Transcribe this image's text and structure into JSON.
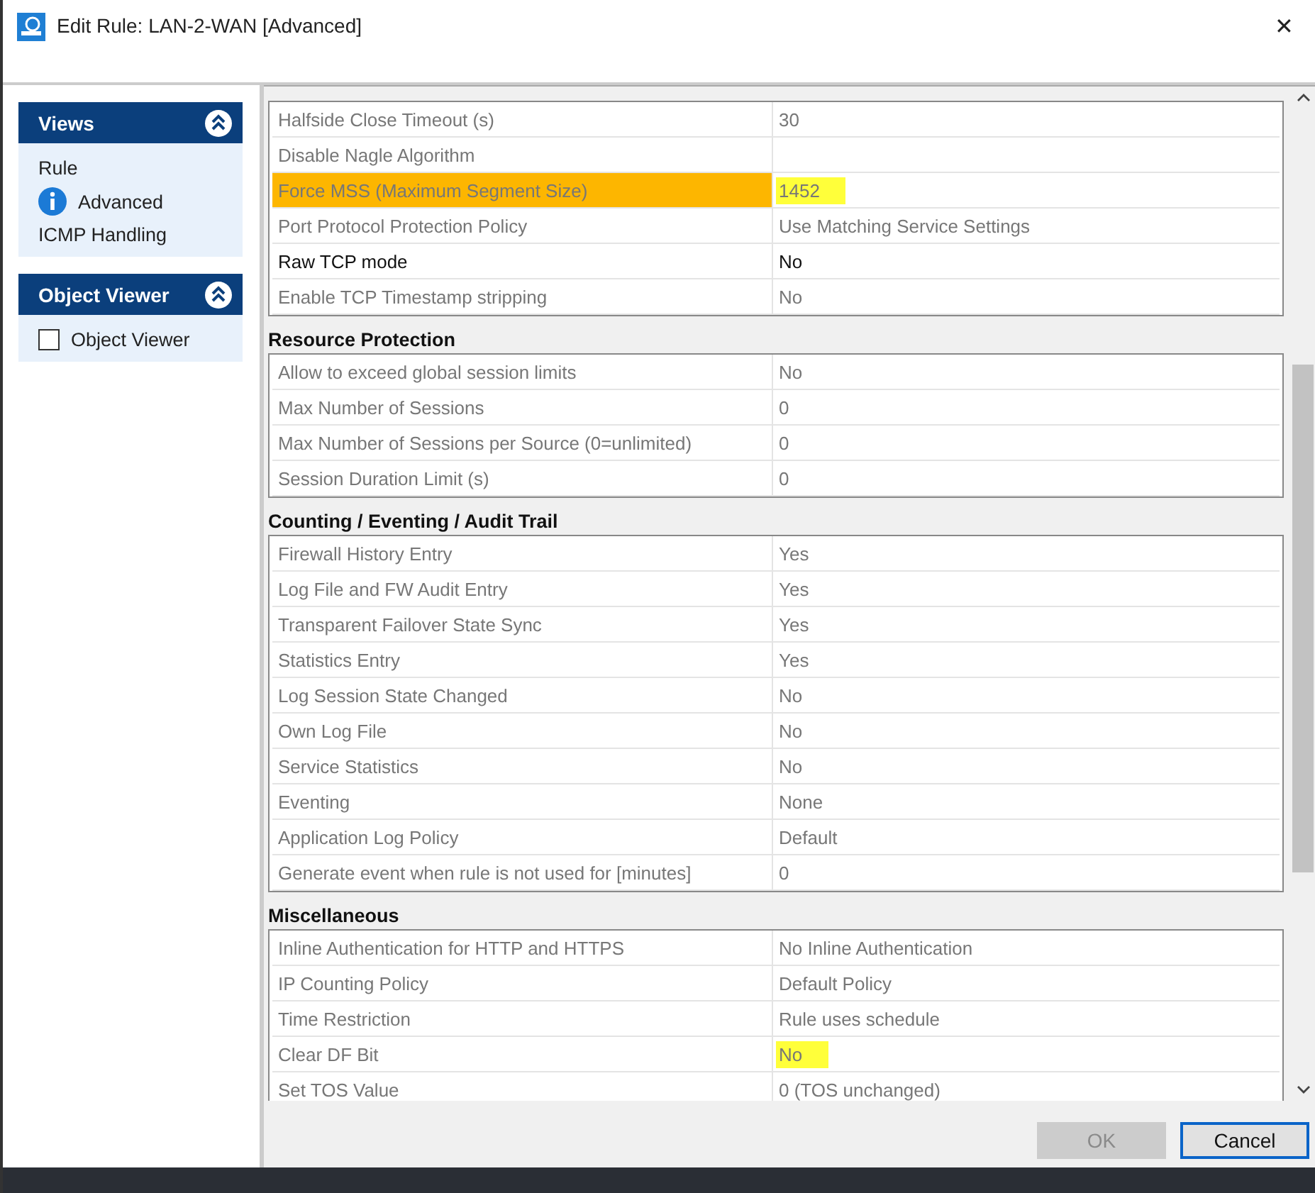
{
  "window": {
    "title": "Edit Rule: LAN-2-WAN [Advanced]",
    "close": "✕"
  },
  "sidebar": {
    "panels": [
      {
        "kind": "views",
        "title": "Views",
        "expanded": true,
        "items": [
          {
            "label": "Rule",
            "selected": false
          },
          {
            "label": "Advanced",
            "selected": true
          },
          {
            "label": "ICMP Handling",
            "selected": false
          }
        ]
      },
      {
        "kind": "checkbox",
        "title": "Object Viewer",
        "expanded": true,
        "items": [
          {
            "label": "Object Viewer",
            "checked": false
          }
        ]
      }
    ]
  },
  "sections": [
    {
      "rows": [
        {
          "label": "Halfside Close Timeout (s)",
          "value": "30",
          "enabled": false,
          "highlighted": false
        },
        {
          "label": "Disable Nagle Algorithm",
          "enabled": false,
          "highlighted": false
        },
        {
          "label": "Force MSS (Maximum Segment Size)",
          "value": "1452",
          "enabled": false,
          "highlighted": true,
          "marked": true
        },
        {
          "label": "Port Protocol Protection Policy",
          "value": "Use Matching Service Settings",
          "enabled": false,
          "highlighted": false
        },
        {
          "label": "Raw TCP mode",
          "value": "No",
          "enabled": true,
          "highlighted": false
        },
        {
          "label": "Enable TCP Timestamp stripping",
          "value": "No",
          "enabled": false,
          "highlighted": false
        }
      ]
    },
    {
      "title": "Resource Protection",
      "rows": [
        {
          "label": "Allow to exceed global session limits",
          "value": "No",
          "enabled": false,
          "highlighted": false
        },
        {
          "label": "Max Number of Sessions",
          "value": "0",
          "enabled": false,
          "highlighted": false
        },
        {
          "label": "Max Number of Sessions per Source (0=unlimited)",
          "value": "0",
          "enabled": false,
          "highlighted": false
        },
        {
          "label": "Session Duration Limit (s)",
          "value": "0",
          "enabled": false,
          "highlighted": false
        }
      ]
    },
    {
      "title": "Counting / Eventing / Audit Trail",
      "rows": [
        {
          "label": "Firewall History Entry",
          "value": "Yes",
          "enabled": false,
          "highlighted": false
        },
        {
          "label": "Log File and FW Audit Entry",
          "value": "Yes",
          "enabled": false,
          "highlighted": false
        },
        {
          "label": "Transparent Failover State Sync",
          "value": "Yes",
          "enabled": false,
          "highlighted": false
        },
        {
          "label": "Statistics Entry",
          "value": "Yes",
          "enabled": false,
          "highlighted": false
        },
        {
          "label": "Log Session State Changed",
          "value": "No",
          "enabled": false,
          "highlighted": false
        },
        {
          "label": "Own Log File",
          "value": "No",
          "enabled": false,
          "highlighted": false
        },
        {
          "label": "Service Statistics",
          "value": "No",
          "enabled": false,
          "highlighted": false
        },
        {
          "label": "Eventing",
          "value": "None",
          "enabled": false,
          "highlighted": false
        },
        {
          "label": "Application Log Policy",
          "value": "Default",
          "enabled": false,
          "highlighted": false
        },
        {
          "label": "Generate event when rule is not used for [minutes]",
          "value": "0",
          "enabled": false,
          "highlighted": false
        }
      ]
    },
    {
      "title": "Miscellaneous",
      "rows": [
        {
          "label": "Inline Authentication for HTTP and HTTPS",
          "value": "No Inline Authentication",
          "enabled": false,
          "highlighted": false
        },
        {
          "label": "IP Counting Policy",
          "value": "Default Policy",
          "enabled": false,
          "highlighted": false
        },
        {
          "label": "Time Restriction",
          "value": "Rule uses schedule",
          "enabled": false,
          "highlighted": false
        },
        {
          "label": "Clear DF Bit",
          "value": "No",
          "enabled": false,
          "highlighted": false,
          "marked": true
        },
        {
          "label": "Set TOS Value",
          "value": "0 (TOS unchanged)",
          "enabled": false,
          "highlighted": false
        }
      ]
    }
  ],
  "buttons": [
    {
      "label": "OK",
      "disabled": true
    },
    {
      "label": "Cancel",
      "disabled": false
    }
  ]
}
